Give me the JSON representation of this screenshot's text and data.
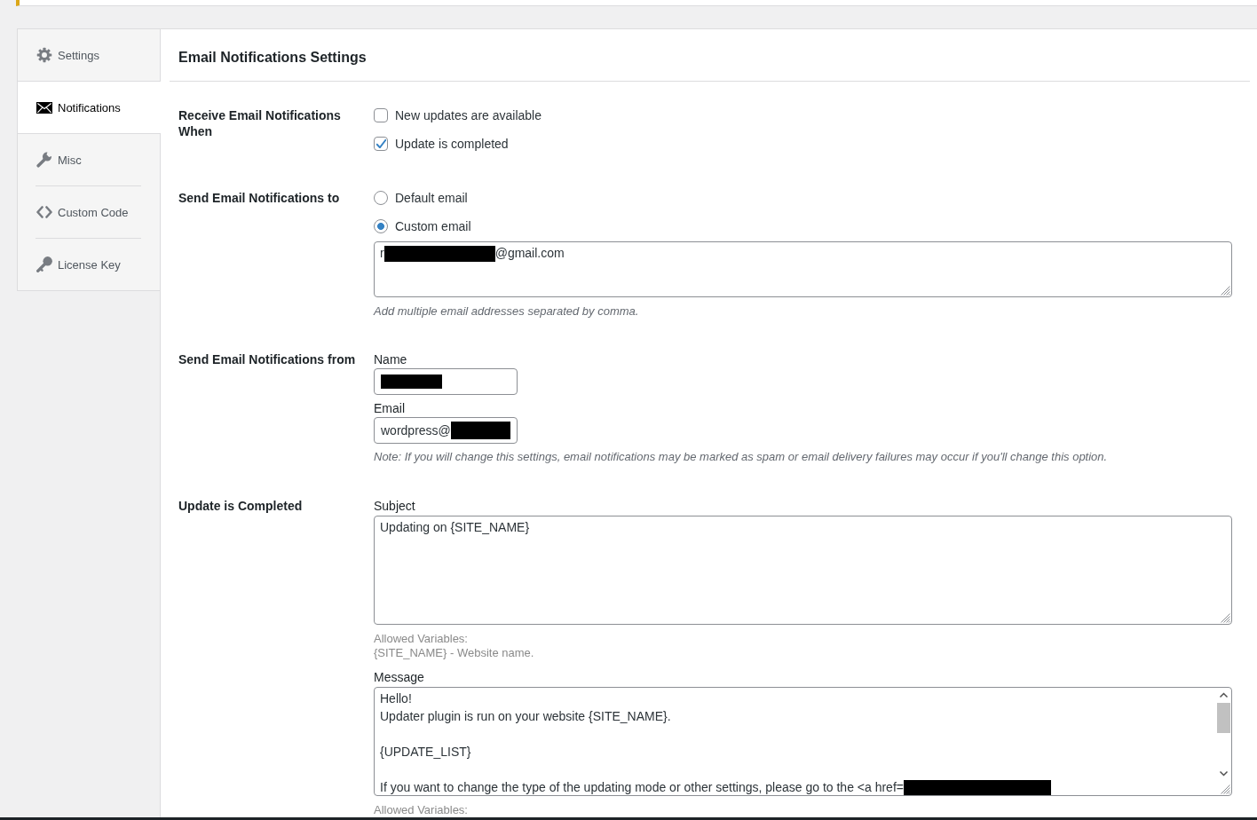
{
  "notice": {
    "kind": "warning"
  },
  "sidebar": {
    "items": [
      {
        "label": "Settings",
        "selected": false
      },
      {
        "label": "Notifications",
        "selected": true
      },
      {
        "label": "Misc",
        "selected": false
      },
      {
        "label": "Custom Code",
        "selected": false
      },
      {
        "label": "License Key",
        "selected": false
      }
    ]
  },
  "panel": {
    "title": "Email Notifications Settings"
  },
  "sections": [
    {
      "kind": "checkboxes",
      "label": "Receive Email Notifications When",
      "options": [
        {
          "label": "New updates are available",
          "checked": false
        },
        {
          "label": "Update is completed",
          "checked": true
        }
      ]
    },
    {
      "kind": "radios",
      "label": "Send Email Notifications to",
      "options": [
        {
          "label": "Default email",
          "selected": false
        },
        {
          "label": "Custom email",
          "selected": true
        }
      ],
      "recipients": {
        "value_start": "r",
        "redacted": true,
        "value_end": "@gmail.com"
      },
      "description": "Add multiple email addresses separated by comma."
    },
    {
      "kind": "sender",
      "label": "Send Email Notifications from",
      "fields": [
        {
          "label": "Name",
          "redacted": true
        },
        {
          "label": "Email",
          "value_start": "wordpress@",
          "redacted": true
        }
      ],
      "note": "Note: If you will change this settings, email notifications may be marked as spam or email delivery failures may occur if you'll change this option."
    },
    {
      "kind": "template",
      "label": "Update is Completed",
      "fields": [
        {
          "label": "Subject",
          "value": "Updating on {SITE_NAME}",
          "variables_title": "Allowed Variables:",
          "variables": [
            "{SITE_NAME} - Website name."
          ]
        },
        {
          "label": "Message",
          "value": "Hello!\nUpdater plugin is run on your website {SITE_NAME}.\n\n{UPDATE_LIST}\n\nIf you want to change the type of the updating mode or other settings, please go to the <a href=",
          "redacted": true,
          "variables_title": "Allowed Variables:"
        }
      ]
    }
  ]
}
